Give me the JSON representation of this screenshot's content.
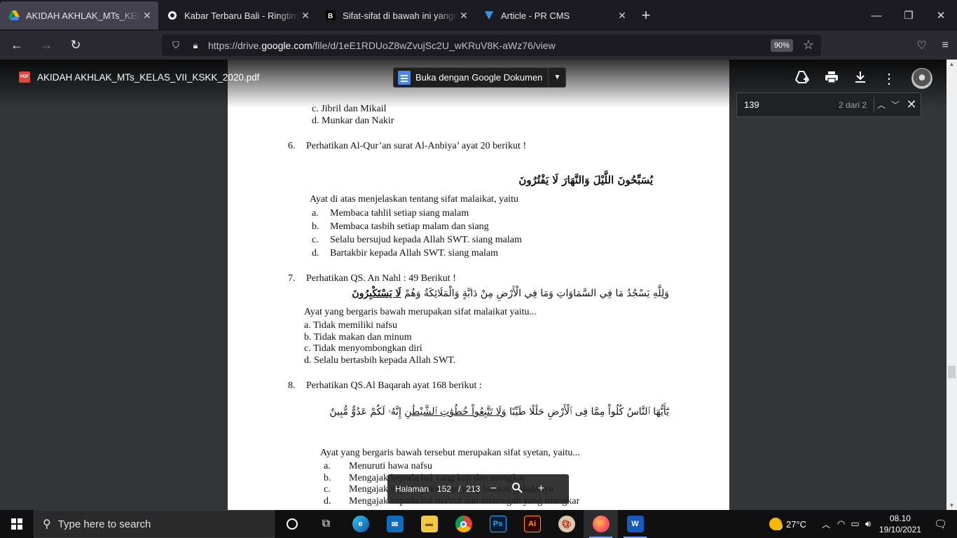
{
  "browser": {
    "tabs": [
      {
        "title": "AKIDAH AKHLAK_MTs_KELAS_V",
        "active": true
      },
      {
        "title": "Kabar Terbaru Bali - Ringtimes B",
        "active": false
      },
      {
        "title": "Sifat-sifat di bawah ini yangmer",
        "active": false
      },
      {
        "title": "Article - PR CMS",
        "active": false
      }
    ],
    "url_prefix": "https://drive.",
    "url_domain": "google.com",
    "url_rest": "/file/d/1eE1RDUoZ8wZvujSc2U_wKRuV8K-aWz76/view",
    "zoom": "90%"
  },
  "viewer": {
    "file_name": "AKIDAH AKHLAK_MTs_KELAS_VII_KSKK_2020.pdf",
    "pdf_badge": "PDF",
    "open_with": "Buka dengan Google Dokumen",
    "find_query": "139",
    "find_count": "2 dari 2",
    "page_label": "Halaman",
    "page_current": "152",
    "page_sep": "/",
    "page_total": "213"
  },
  "document": {
    "q5c": "c.  Jibril dan Mikail",
    "q5d": "d.  Munkar dan Nakir",
    "q6_num": "6.",
    "q6_text": "Perhatikan Al-Qur’an  surat  Al-Anbiya’ ayat 20 berikut !",
    "q6_arabic": "يُسَبِّحُونَ اللَّيْلَ وَالنَّهَارَ لَا يَفْتُرُونَ",
    "q6_stem": "Ayat di atas menjelaskan tentang sifat  malaikat, yaitu",
    "q6_opts": [
      {
        "k": "a.",
        "t": "Membaca tahlil setiap siang malam"
      },
      {
        "k": "b.",
        "t": "Membaca tasbih setiap malam dan siang"
      },
      {
        "k": "c.",
        "t": "Selalu bersujud kepada Allah SWT. siang malam"
      },
      {
        "k": "d.",
        "t": "Bartakbir kepada Allah SWT. siang malam"
      }
    ],
    "q7_num": "7.",
    "q7_text": "Perhatikan QS. An Nahl : 49  Berikut !",
    "q7_arabic": "وَلِلَّهِ يَسْجُدُ مَا فِي السَّمَاوَاتِ وَمَا فِي الْأَرْضِ مِنْ دَابَّةٍ وَالْمَلَائِكَةُ وَهُمْ",
    "q7_arabic_u": "لَا يَسْتَكْبِرُونَ",
    "q7_stem": "Ayat yang bergaris bawah merupakan sifat malaikat yaitu...",
    "q7_opts": [
      "a.  Tidak memiliki nafsu",
      "b.  Tidak makan dan minum",
      "c.  Tidak menyombongkan diri",
      "d.  Selalu bertasbih kepada Allah SWT."
    ],
    "q8_num": "8.",
    "q8_text": "Perhatikan QS.Al Baqarah ayat 168 berikut :",
    "q8_arabic_a": "يَٰٓأَيُّهَا ٱلنَّاسُ كُلُواْ مِمَّا فِى ٱلْأَرْضِ حَلَٰلًا طَيِّبًا",
    "q8_arabic_u": "وَلَا تَتَّبِعُواْ خُطُوَٰتِ ٱلشَّيْطَٰنِ",
    "q8_arabic_b": "إِنَّهُۥ لَكُمْ عَدُوٌّ مُّبِينٌ",
    "q8_stem": "Ayat yang bergaris bawah tersebut  merupakan sifat  syetan, yaitu...",
    "q8_opts": [
      {
        "k": "a.",
        "t": "Menuruti hawa nafsu"
      },
      {
        "k": "b.",
        "t": "Mengajak kepada  hal yang keji dan mungkar"
      },
      {
        "k": "c.",
        "t": "Mengajak kepada pekerjaan yang banyak pahalanya"
      },
      {
        "k": "d.",
        "t": "Mengajak kepada hal ma’ruf dan mencegah yang mungkar"
      }
    ]
  },
  "taskbar": {
    "search_placeholder": "Type here to search",
    "temperature": "27°C",
    "time": "08.10",
    "date": "19/10/2021",
    "apps": [
      "task-view",
      "edge",
      "mail",
      "file-explorer",
      "chrome",
      "photoshop",
      "illustrator",
      "paint",
      "firefox",
      "word"
    ]
  },
  "colors": {
    "page_bg": "#323639",
    "tab_active": "#42414d",
    "taskbar": "#101010"
  }
}
